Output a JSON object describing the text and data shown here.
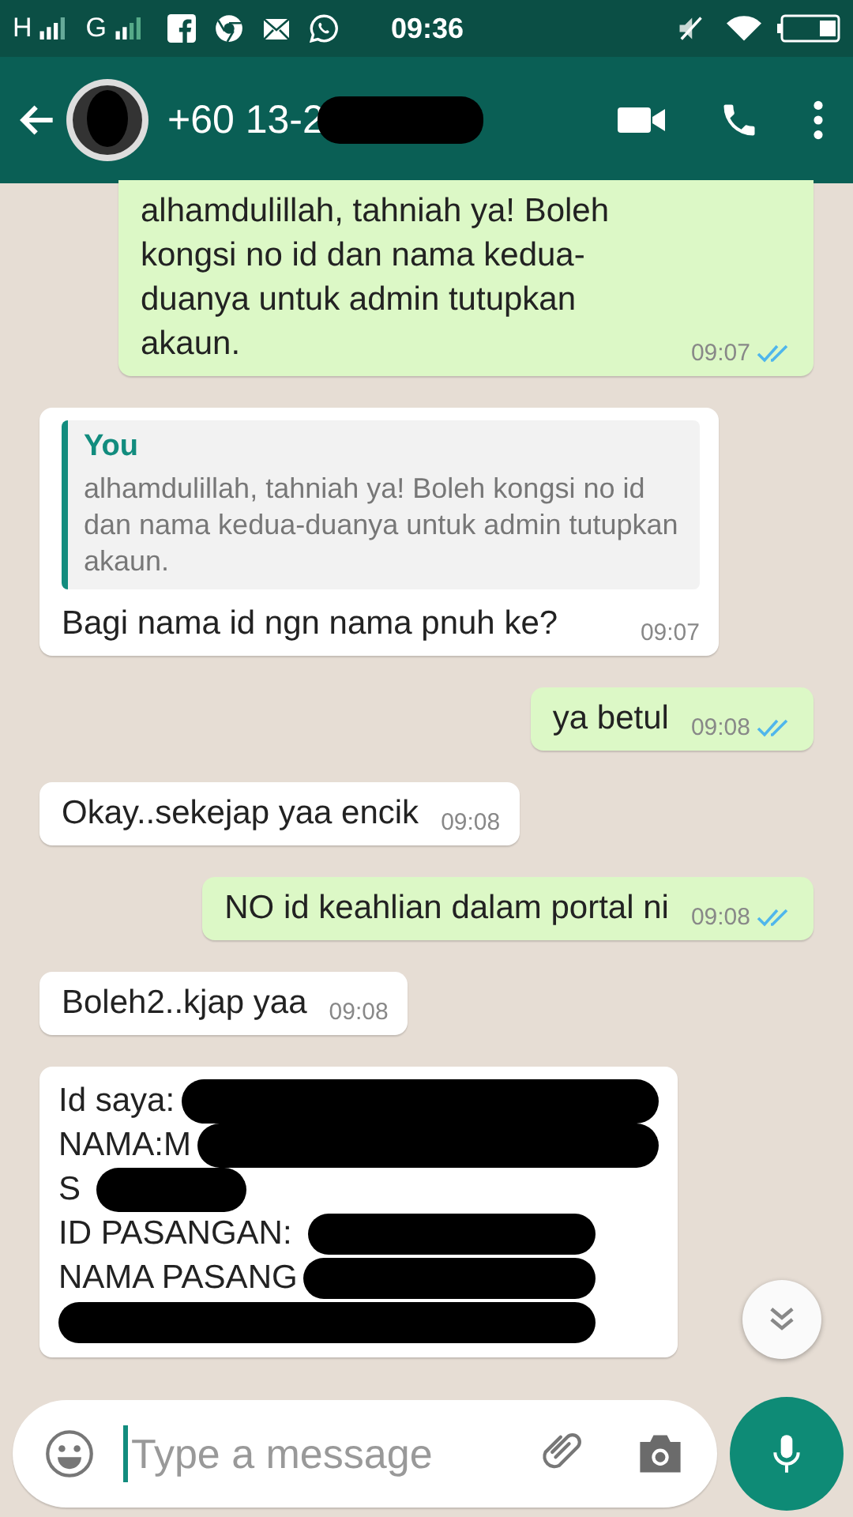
{
  "status_bar": {
    "network_1": "H",
    "network_2": "G",
    "time": "09:36"
  },
  "header": {
    "contact": "+60 13-2",
    "redacted": true
  },
  "messages": [
    {
      "kind": "outgoing",
      "text": "alhamdulillah, tahniah ya! Boleh kongsi no id dan nama kedua-duanya untuk admin tutupkan akaun.",
      "time": "09:07",
      "read": true
    },
    {
      "kind": "incoming",
      "quote": {
        "author": "You",
        "text": "alhamdulillah, tahniah ya! Boleh kongsi no id dan nama kedua-duanya untuk admin tutupkan akaun."
      },
      "text": "Bagi nama id ngn nama pnuh ke?",
      "time": "09:07"
    },
    {
      "kind": "outgoing",
      "text": "ya betul",
      "time": "09:08",
      "read": true
    },
    {
      "kind": "incoming",
      "text": "Okay..sekejap yaa encik",
      "time": "09:08"
    },
    {
      "kind": "outgoing",
      "text": "NO id keahlian dalam portal ni",
      "time": "09:08",
      "read": true
    },
    {
      "kind": "incoming",
      "text": "Boleh2..kjap yaa",
      "time": "09:08"
    },
    {
      "kind": "redacted",
      "lines": [
        {
          "text": "Id saya:",
          "redacted": true
        },
        {
          "text": "NAMA:M",
          "redacted": true
        },
        {
          "text": "S",
          "redacted": true
        },
        {
          "text": "ID PASANGAN:",
          "redacted": true
        },
        {
          "text": "NAMA PASANG",
          "redacted": true
        },
        {
          "redacted": true
        }
      ]
    }
  ],
  "composer": {
    "placeholder": "Type a message"
  }
}
